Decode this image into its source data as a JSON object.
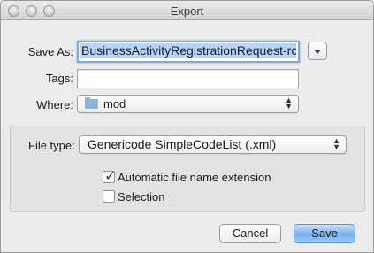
{
  "window": {
    "title": "Export"
  },
  "save_as": {
    "label": "Save As:",
    "value": "BusinessActivityRegistrationRequest-rc"
  },
  "tags": {
    "label": "Tags:",
    "value": ""
  },
  "where": {
    "label": "Where:",
    "value": "mod"
  },
  "file_type": {
    "label": "File type:",
    "selected": "Genericode SimpleCodeList (.xml)"
  },
  "options": {
    "auto_ext_label": "Automatic file name extension",
    "auto_ext_checked": true,
    "selection_label": "Selection",
    "selection_checked": false
  },
  "buttons": {
    "cancel": "Cancel",
    "save": "Save"
  },
  "colors": {
    "accent": "#79aef0",
    "selection_highlight": "#b5d5ff"
  },
  "icons": [
    "close-icon",
    "minimize-icon",
    "zoom-icon",
    "disclosure-triangle-icon",
    "folder-icon",
    "popup-arrows-icon",
    "checkmark-icon"
  ]
}
